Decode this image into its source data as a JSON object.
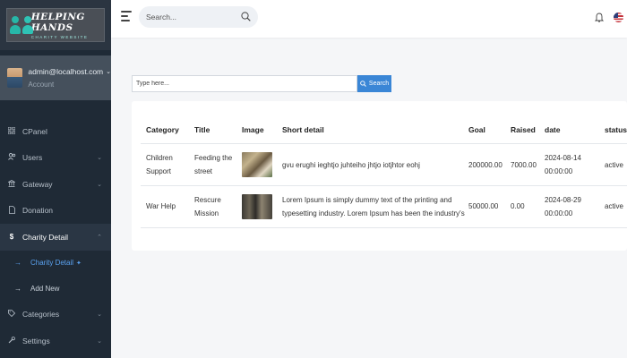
{
  "sidebar": {
    "logo": {
      "title": "HELPING HANDS",
      "subtitle": "CHARITY WEBSITE"
    },
    "user": {
      "email": "admin@localhost.com",
      "role": "Account"
    },
    "menu": [
      {
        "label": "CPanel",
        "icon": "grid-icon"
      },
      {
        "label": "Users",
        "icon": "users-icon"
      },
      {
        "label": "Gateway",
        "icon": "bank-icon"
      },
      {
        "label": "Donation",
        "icon": "file-icon"
      },
      {
        "label": "Charity Detail",
        "icon": "dollar-icon"
      },
      {
        "label": "Categories",
        "icon": "tag-icon"
      },
      {
        "label": "Settings",
        "icon": "wrench-icon"
      }
    ],
    "submenu": [
      {
        "label": "Charity Detail"
      },
      {
        "label": "Add New"
      }
    ]
  },
  "topbar": {
    "search_placeholder": "Search..."
  },
  "filter": {
    "placeholder": "Type here...",
    "button_label": "Search"
  },
  "table": {
    "headers": [
      "Category",
      "Title",
      "Image",
      "Short detail",
      "Goal",
      "Raised",
      "date",
      "status"
    ],
    "rows": [
      {
        "category": [
          "Children",
          "Support"
        ],
        "title": [
          "Feeding the",
          "street"
        ],
        "short_detail": "gvu erughi ieghtjo juhteiho jhtjo iotjhtor eohj",
        "goal": "200000.00",
        "raised": "7000.00",
        "date": [
          "2024-08-14",
          "00:00:00"
        ],
        "status": "active"
      },
      {
        "category": [
          "War Help"
        ],
        "title": [
          "Rescure",
          "Mission"
        ],
        "short_detail": [
          "Lorem Ipsum is simply dummy text of the printing and",
          "typesetting industry. Lorem Ipsum has been the industry's"
        ],
        "goal": "50000.00",
        "raised": "0.00",
        "date": [
          "2024-08-29",
          "00:00:00"
        ],
        "status": "active"
      }
    ]
  },
  "colors": {
    "sidebar_bg": "#1f2a36",
    "accent": "#3a86d6",
    "active_link": "#5aa2f0"
  }
}
